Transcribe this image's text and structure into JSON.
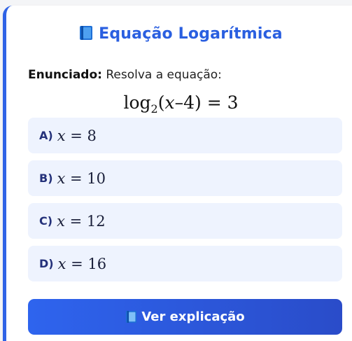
{
  "header": {
    "icon": "book-icon",
    "title": "Equação Logarítmica"
  },
  "statement": {
    "label": "Enunciado:",
    "text": "Resolva a equação:"
  },
  "equation": {
    "func": "log",
    "base": "2",
    "open": "(",
    "var": "x",
    "minus": "–4",
    "close": ")",
    "rhs": " = 3"
  },
  "options": [
    {
      "letter": "A)",
      "var": "x",
      "rhs": " = 8"
    },
    {
      "letter": "B)",
      "var": "x",
      "rhs": " = 10"
    },
    {
      "letter": "C)",
      "var": "x",
      "rhs": " = 12"
    },
    {
      "letter": "D)",
      "var": "x",
      "rhs": " = 16"
    }
  ],
  "button": {
    "icon": "book-icon",
    "label": "Ver explicação"
  },
  "colors": {
    "accent": "#2a5fe0",
    "option_bg": "#eef3fe",
    "button_start": "#2e64ee",
    "button_end": "#2a4cc9"
  }
}
